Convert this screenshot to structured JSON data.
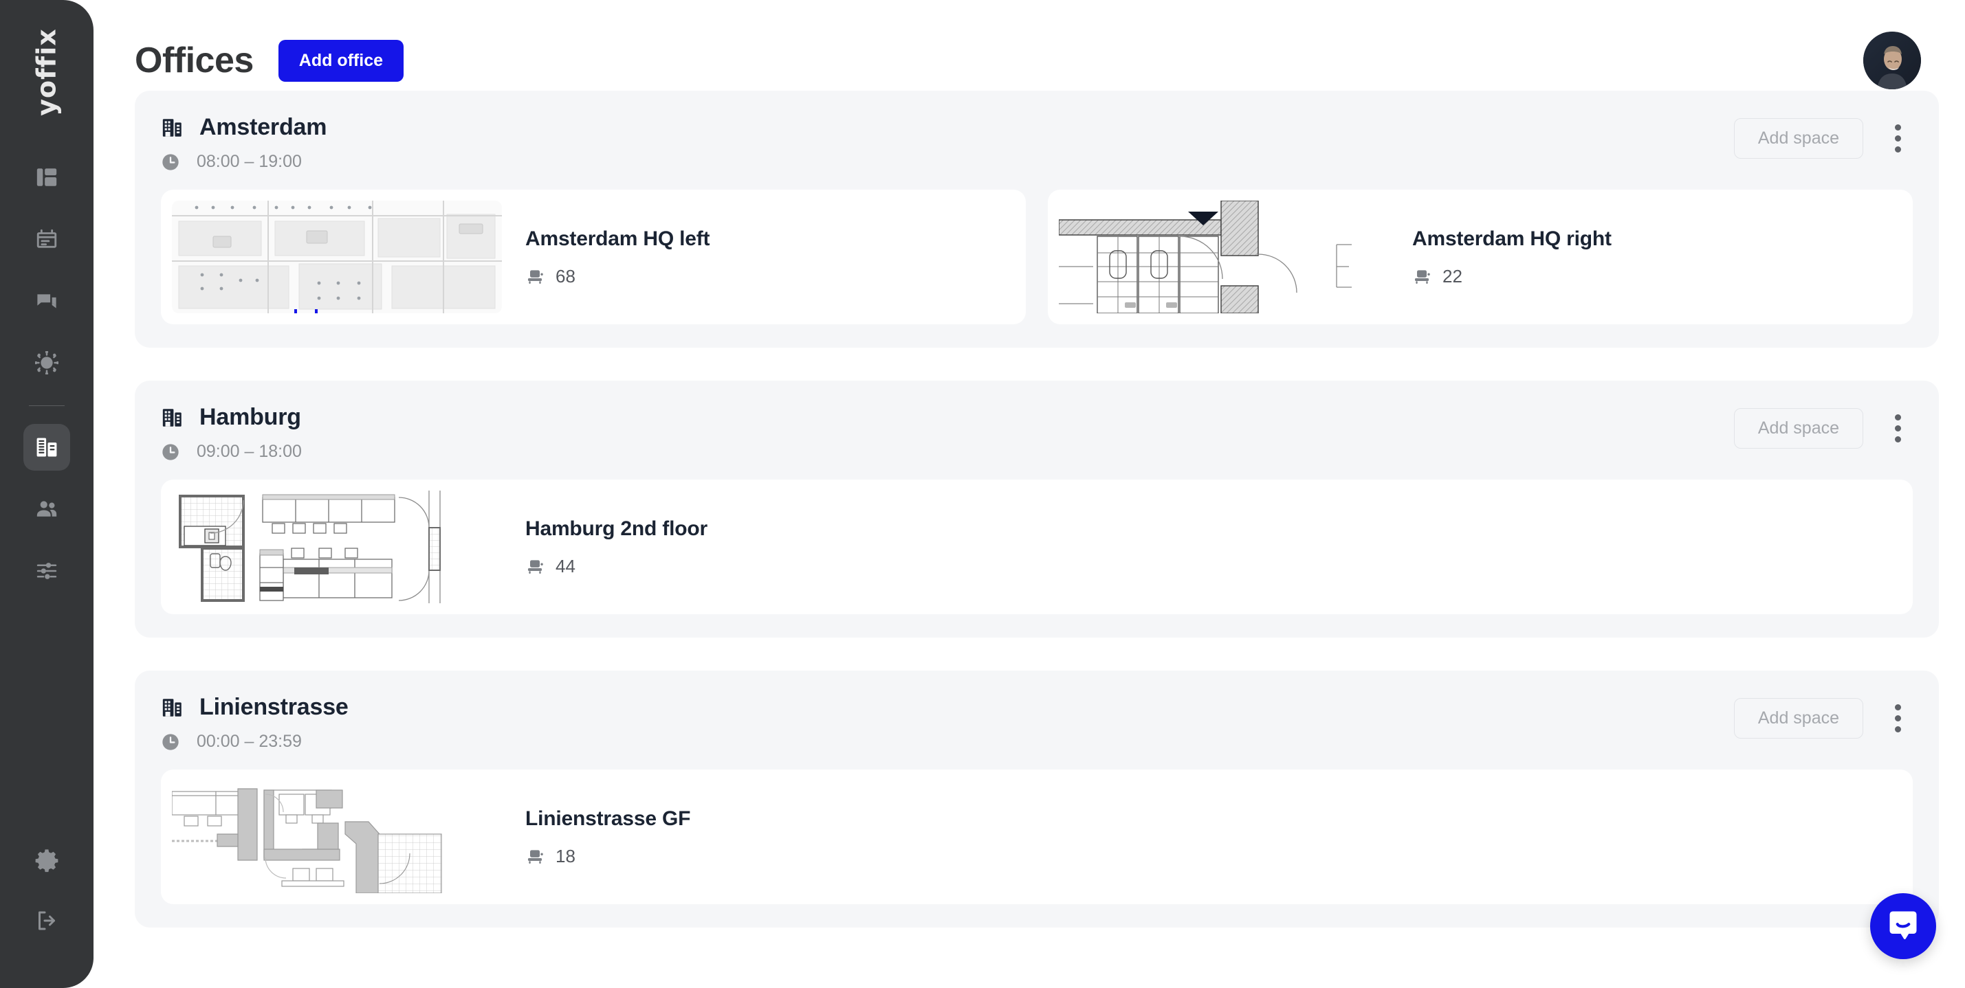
{
  "brand": {
    "logo_text": "yoffix",
    "accent_color": "#1515e8",
    "sidebar_color": "#343638"
  },
  "sidebar": {
    "top_items": [
      {
        "name": "dashboard",
        "icon": "dashboard-icon",
        "active": false
      },
      {
        "name": "calendar",
        "icon": "calendar-icon",
        "active": false
      },
      {
        "name": "chat",
        "icon": "chat-icon",
        "active": false
      },
      {
        "name": "health",
        "icon": "virus-icon",
        "active": false
      },
      {
        "name": "offices",
        "icon": "office-building-icon",
        "active": true
      },
      {
        "name": "people",
        "icon": "people-icon",
        "active": false
      },
      {
        "name": "settings-sliders",
        "icon": "sliders-icon",
        "active": false
      }
    ],
    "bottom_items": [
      {
        "name": "settings",
        "icon": "gear-icon"
      },
      {
        "name": "logout",
        "icon": "logout-icon"
      }
    ]
  },
  "header": {
    "title": "Offices",
    "add_office_label": "Add office",
    "avatar_alt": "User avatar"
  },
  "offices": [
    {
      "name": "Amsterdam",
      "hours": "08:00  –  19:00",
      "add_space_label": "Add space",
      "spaces": [
        {
          "title": "Amsterdam HQ left",
          "capacity": "68",
          "plan": "open-office"
        },
        {
          "title": "Amsterdam HQ right",
          "capacity": "22",
          "plan": "bathrooms"
        }
      ]
    },
    {
      "name": "Hamburg",
      "hours": "09:00  –  18:00",
      "add_space_label": "Add space",
      "spaces": [
        {
          "title": "Hamburg 2nd floor",
          "capacity": "44",
          "plan": "desks"
        }
      ]
    },
    {
      "name": "Linienstrasse",
      "hours": "00:00  –  23:59",
      "add_space_label": "Add space",
      "spaces": [
        {
          "title": "Linienstrasse GF",
          "capacity": "18",
          "plan": "ground-floor"
        }
      ]
    }
  ],
  "intercom": {
    "label": "Open chat"
  }
}
